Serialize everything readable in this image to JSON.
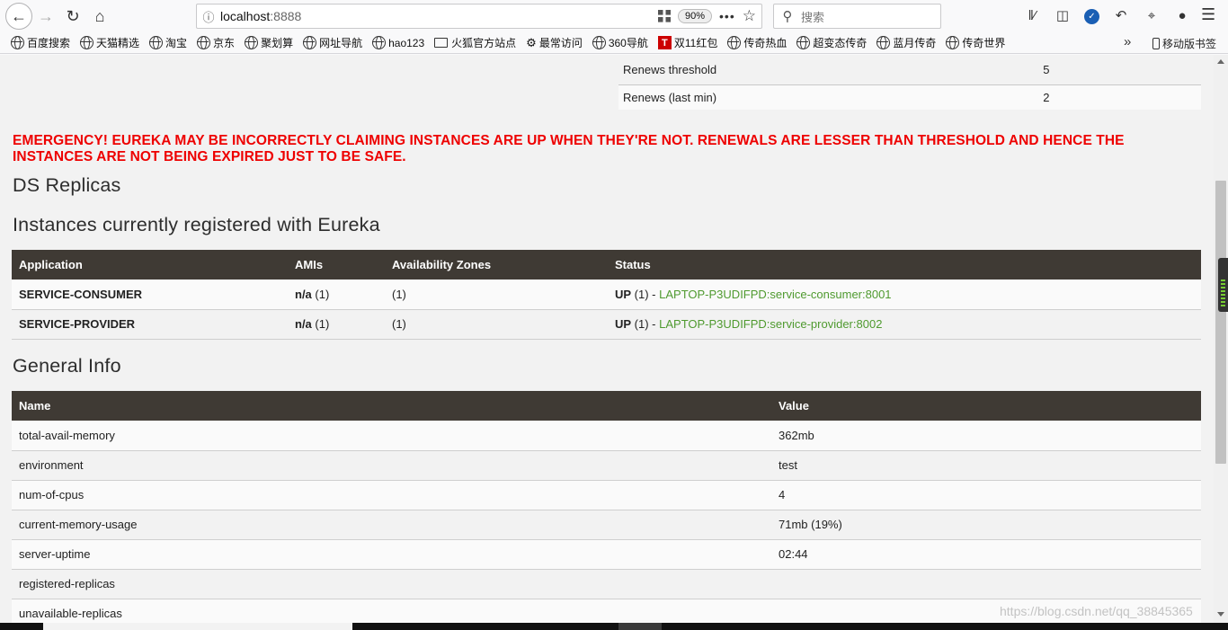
{
  "browser": {
    "url_host": "localhost",
    "url_port": ":8888",
    "zoom": "90%",
    "search_placeholder": "搜索",
    "bookmarks": [
      "百度搜索",
      "天猫精选",
      "淘宝",
      "京东",
      "聚划算",
      "网址导航",
      "hao123",
      "火狐官方站点",
      "最常访问",
      "360导航",
      "双11红包",
      "传奇热血",
      "超变态传奇",
      "蓝月传奇",
      "传奇世界"
    ],
    "mobile_bookmarks": "移动版书签"
  },
  "lease_info": [
    {
      "name": "Renews threshold",
      "value": "5"
    },
    {
      "name": "Renews (last min)",
      "value": "2"
    }
  ],
  "emergency": "EMERGENCY! EUREKA MAY BE INCORRECTLY CLAIMING INSTANCES ARE UP WHEN THEY'RE NOT. RENEWALS ARE LESSER THAN THRESHOLD AND HENCE THE INSTANCES ARE NOT BEING EXPIRED JUST TO BE SAFE.",
  "headings": {
    "ds_replicas": "DS Replicas",
    "instances": "Instances currently registered with Eureka",
    "general": "General Info"
  },
  "instances": {
    "columns": [
      "Application",
      "AMIs",
      "Availability Zones",
      "Status"
    ],
    "rows": [
      {
        "app": "SERVICE-CONSUMER",
        "ami": "n/a",
        "ami_count": " (1)",
        "zones": "(1)",
        "status": "UP",
        "status_count": " (1) - ",
        "link": "LAPTOP-P3UDIFPD:service-consumer:8001"
      },
      {
        "app": "SERVICE-PROVIDER",
        "ami": "n/a",
        "ami_count": " (1)",
        "zones": "(1)",
        "status": "UP",
        "status_count": " (1) - ",
        "link": "LAPTOP-P3UDIFPD:service-provider:8002"
      }
    ]
  },
  "general": {
    "columns": [
      "Name",
      "Value"
    ],
    "rows": [
      {
        "name": "total-avail-memory",
        "value": "362mb"
      },
      {
        "name": "environment",
        "value": "test"
      },
      {
        "name": "num-of-cpus",
        "value": "4"
      },
      {
        "name": "current-memory-usage",
        "value": "71mb (19%)"
      },
      {
        "name": "server-uptime",
        "value": "02:44"
      },
      {
        "name": "registered-replicas",
        "value": ""
      },
      {
        "name": "unavailable-replicas",
        "value": ""
      }
    ]
  },
  "watermark": "https://blog.csdn.net/qq_38845365"
}
